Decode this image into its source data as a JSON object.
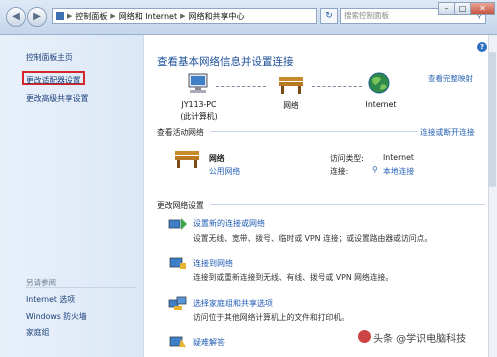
{
  "addressbar": {
    "segments": [
      "控制面板",
      "网络和 Internet",
      "网络和共享中心"
    ],
    "search_placeholder": "搜索控制面板"
  },
  "window": {
    "minimize": "–",
    "maximize": "□",
    "close": "✕"
  },
  "sidebar": {
    "home": "控制面板主页",
    "adapter": "更改适配器设置",
    "advanced_share": "更改高级共享设置",
    "see_also": "另请参阅",
    "internet_options": "Internet 选项",
    "firewall": "Windows 防火墙",
    "homegroup": "家庭组"
  },
  "header": {
    "title": "查看基本网络信息并设置连接",
    "full_map": "查看完整映射"
  },
  "map": {
    "computer_name": "JY113-PC",
    "computer_sub": "(此计算机)",
    "network": "网络",
    "internet": "Internet"
  },
  "active": {
    "title": "查看活动网络",
    "connect_disconnect": "连接或断开连接",
    "network_name": "网络",
    "network_type": "公用网络",
    "access_type_label": "访问类型:",
    "access_type_value": "Internet",
    "connection_label": "连接:",
    "connection_value": "本地连接"
  },
  "settings": {
    "title": "更改网络设置",
    "tasks": [
      {
        "title": "设置新的连接或网络",
        "desc": "设置无线、宽带、拨号、临时或 VPN 连接；或设置路由器或访问点。"
      },
      {
        "title": "连接到网络",
        "desc": "连接到或重新连接到无线、有线、拨号或 VPN 网络连接。"
      },
      {
        "title": "选择家庭组和共享选项",
        "desc": "访问位于其他网络计算机上的文件和打印机。"
      },
      {
        "title": "疑难解答",
        "desc": ""
      }
    ]
  },
  "watermark": "头条 @学识电脑科技"
}
